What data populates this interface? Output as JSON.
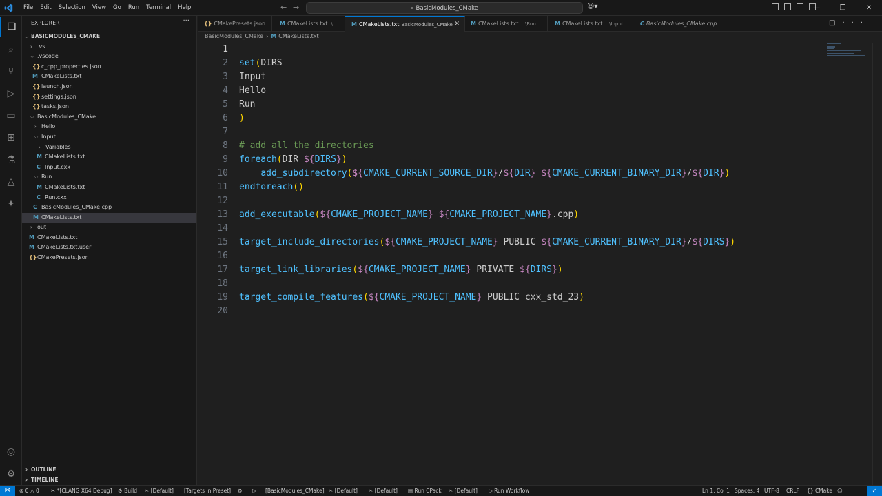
{
  "menu": [
    "File",
    "Edit",
    "Selection",
    "View",
    "Go",
    "Run",
    "Terminal",
    "Help"
  ],
  "search": "BasicModules_CMake",
  "sidebar": {
    "title": "EXPLORER",
    "root": "BASICMODULES_CMAKE",
    "items": [
      {
        "label": ".vs"
      },
      {
        "label": ".vscode"
      },
      {
        "label": "c_cpp_properties.json",
        "icon": "{}"
      },
      {
        "label": "CMakeLists.txt",
        "icon": "M"
      },
      {
        "label": "launch.json",
        "icon": "{}"
      },
      {
        "label": "settings.json",
        "icon": "{}"
      },
      {
        "label": "tasks.json",
        "icon": "{}"
      },
      {
        "label": "BasicModules_CMake"
      },
      {
        "label": "Hello"
      },
      {
        "label": "Input"
      },
      {
        "label": "Variables"
      },
      {
        "label": "CMakeLists.txt",
        "icon": "M"
      },
      {
        "label": "Input.cxx",
        "icon": "C"
      },
      {
        "label": "Run"
      },
      {
        "label": "CMakeLists.txt",
        "icon": "M"
      },
      {
        "label": "Run.cxx",
        "icon": "C"
      },
      {
        "label": "BasicModules_CMake.cpp",
        "icon": "C"
      },
      {
        "label": "CMakeLists.txt",
        "icon": "M"
      },
      {
        "label": "out"
      },
      {
        "label": "CMakeLists.txt",
        "icon": "M"
      },
      {
        "label": "CMakeLists.txt.user",
        "icon": "M"
      },
      {
        "label": "CMakePresets.json",
        "icon": "{}"
      }
    ],
    "outline": "OUTLINE",
    "timeline": "TIMELINE"
  },
  "tabs": [
    {
      "label": "CMakePresets.json",
      "desc": "",
      "icon": "{}"
    },
    {
      "label": "CMakeLists.txt",
      "desc": ".\\",
      "icon": "M"
    },
    {
      "label": "CMakeLists.txt",
      "desc": "BasicModules_CMake",
      "icon": "M"
    },
    {
      "label": "CMakeLists.txt",
      "desc": "...\\Run",
      "icon": "M"
    },
    {
      "label": "CMakeLists.txt",
      "desc": "...\\Input",
      "icon": "M"
    },
    {
      "label": "BasicModules_CMake.cpp",
      "desc": "",
      "icon": ""
    }
  ],
  "breadcrumb": {
    "folder": "BasicModules_CMake",
    "file": "CMakeLists.txt",
    "icon": "M"
  },
  "code": {
    "dirs": "DIRS",
    "input": "Input",
    "hello": "Hello",
    "run": "Run",
    "comment": "# add all the directories",
    "dir": "DIR",
    "src_dir": "CMAKE_CURRENT_SOURCE_DIR",
    "bin_dir": "CMAKE_CURRENT_BINARY_DIR",
    "proj": "CMAKE_PROJECT_NAME",
    "cpp": ".cpp",
    "public": "PUBLIC",
    "private": "PRIVATE",
    "feature": "cxx_std_23",
    "kw_set": "set",
    "kw_foreach": "foreach",
    "kw_add_sub": "add_subdirectory",
    "kw_endforeach": "endforeach",
    "kw_add_exe": "add_executable",
    "kw_tid": "target_include_directories",
    "kw_tll": "target_link_libraries",
    "kw_tcf": "target_compile_features"
  },
  "status": {
    "errors": "0",
    "warnings": "0",
    "kit": "*[CLANG X64 Debug]",
    "build": "Build",
    "default1": "[Default]",
    "targets": "[Targets In Preset]",
    "project": "[BasicModules_CMake]",
    "default2": "[Default]",
    "default3": "[Default]",
    "run_cpack": "Run CPack",
    "default4": "[Default]",
    "run_workflow": "Run Workflow",
    "position": "Ln 1, Col 1",
    "spaces": "Spaces: 4",
    "encoding": "UTF-8",
    "eol": "CRLF",
    "language": "CMake"
  },
  "colors": {
    "accent": "#0078d4",
    "function": "#4fc1ff",
    "variable": "#c586c0",
    "comment": "#6a9955",
    "bracket": "#ffd700"
  }
}
